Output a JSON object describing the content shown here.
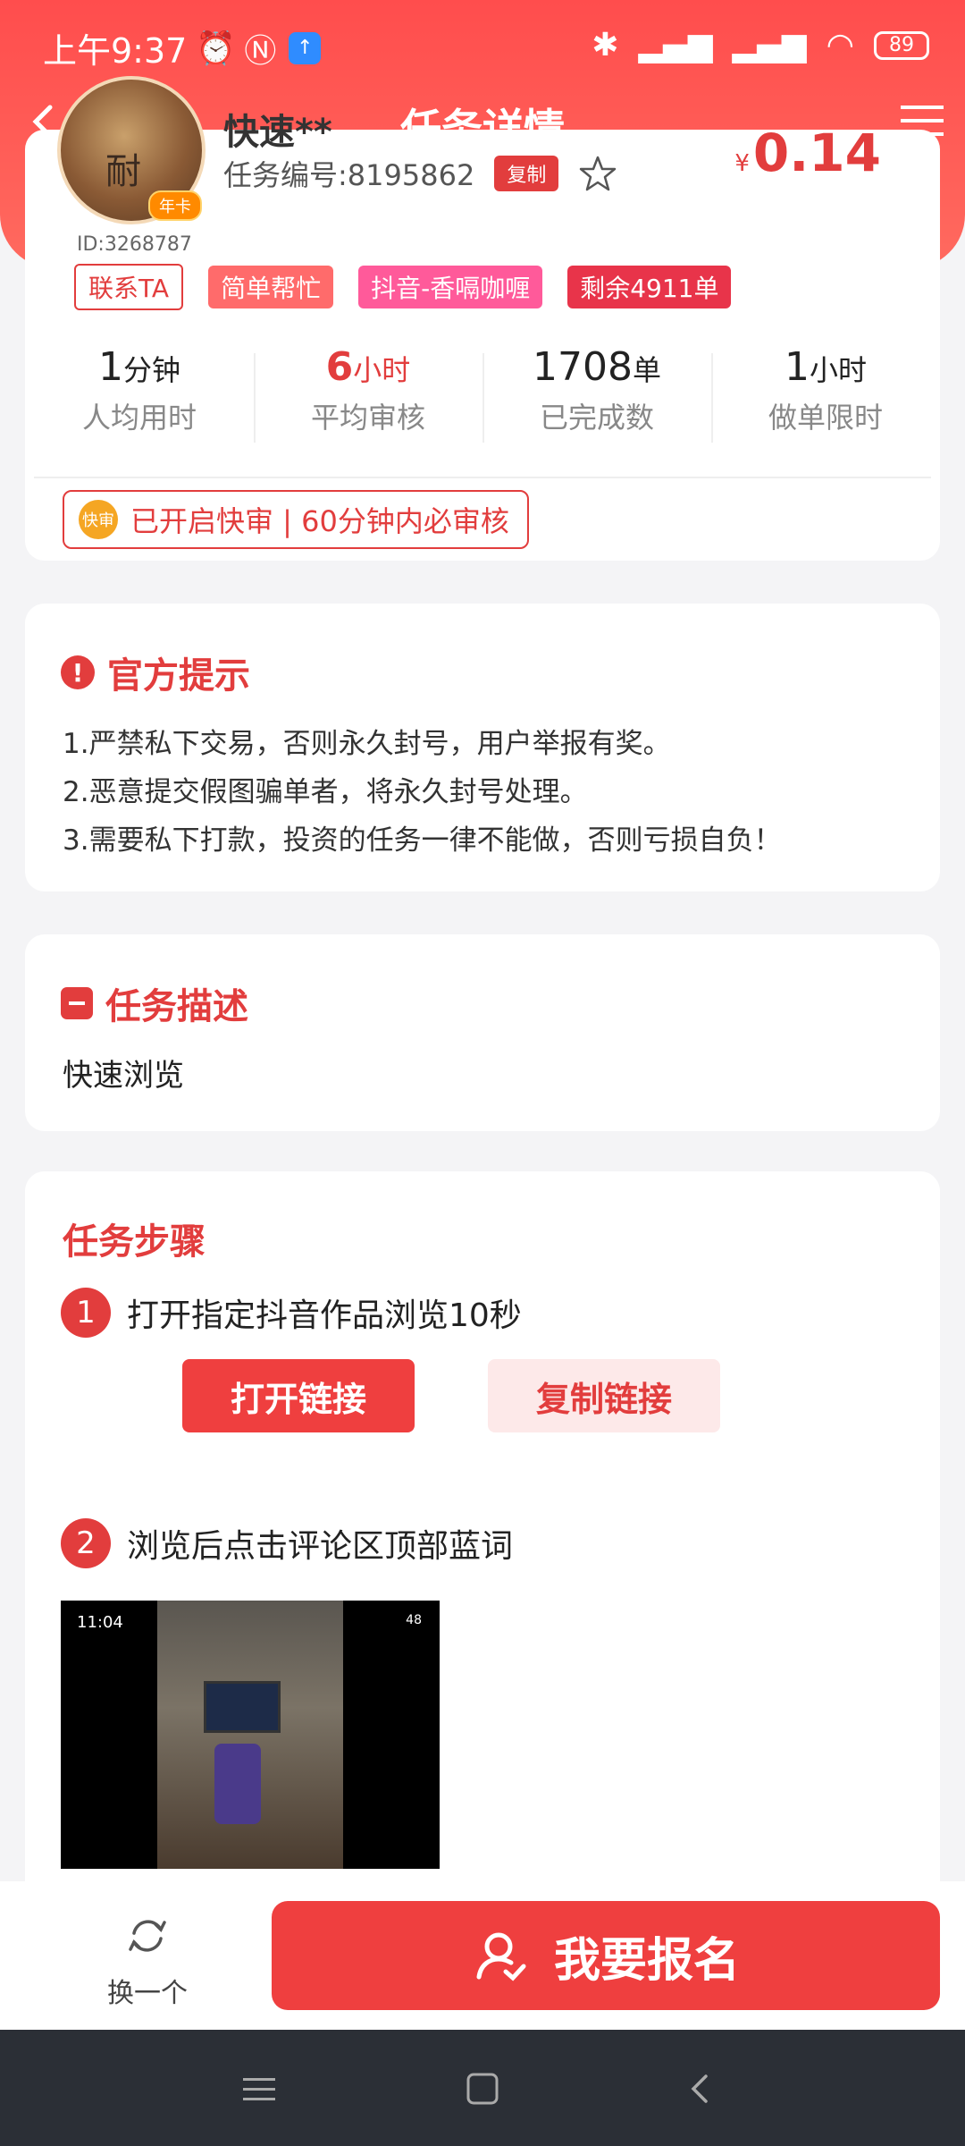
{
  "status": {
    "time": "上午9:37",
    "battery": "89"
  },
  "nav": {
    "title": "任务详情"
  },
  "task": {
    "user_name": "快速**",
    "user_id": "ID:3268787",
    "avatar_badge": "年卡",
    "task_no": "任务编号:8195862",
    "copy_label": "复制",
    "price_symbol": "¥",
    "price": "0.14",
    "tags": {
      "contact": "联系TA",
      "t1": "简单帮忙",
      "t2": "抖音-香嗝咖喱",
      "t3": "剩余4911单"
    },
    "stats": [
      {
        "value": "1",
        "unit": "分钟",
        "label": "人均用时"
      },
      {
        "value": "6",
        "unit": "小时",
        "label": "平均审核"
      },
      {
        "value": "1708",
        "unit": "单",
        "label": "已完成数"
      },
      {
        "value": "1",
        "unit": "小时",
        "label": "做单限时"
      }
    ],
    "fast_badge": "快审",
    "fast_text": "已开启快审 | 60分钟内必审核"
  },
  "tips": {
    "title": "官方提示",
    "items": [
      "1.严禁私下交易，否则永久封号，用户举报有奖。",
      "2.恶意提交假图骗单者，将永久封号处理。",
      "3.需要私下打款，投资的任务一律不能做，否则亏损自负！"
    ]
  },
  "description": {
    "title": "任务描述",
    "text": "快速浏览"
  },
  "steps": {
    "title": "任务步骤",
    "step1": {
      "num": "1",
      "text": "打开指定抖音作品浏览10秒"
    },
    "open_label": "打开链接",
    "copy_link_label": "复制链接",
    "step2": {
      "num": "2",
      "text": "浏览后点击评论区顶部蓝词"
    },
    "shot_time": "11:04",
    "shot_battery": "48"
  },
  "bottom": {
    "switch_label": "换一个",
    "signup_label": "我要报名"
  },
  "colors": {
    "accent": "#e23d3d",
    "header": "#ff4d4d"
  }
}
